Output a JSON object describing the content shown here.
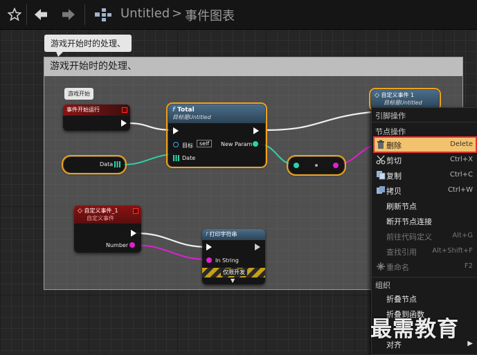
{
  "toolbar": {
    "favorite_icon": "star-outline-icon",
    "back_icon": "arrow-left-icon",
    "forward_icon": "arrow-right-icon",
    "graph_icon": "blueprint-graph-icon",
    "breadcrumb_root": "Untitled",
    "breadcrumb_separator": ">",
    "breadcrumb_current": "事件图表"
  },
  "comment": {
    "bubble_text": "游戏开始时的处理、",
    "title": "游戏开始时的处理、"
  },
  "nodes": {
    "begin_play": {
      "bubble": "游戏开始",
      "title": "事件开始运行",
      "color": "#8a1212"
    },
    "data_var": {
      "label": "Data"
    },
    "total": {
      "title": "Total",
      "subtitle": "目标是Untitled",
      "target_label": "目标",
      "self_value": "self",
      "new_param": "New Param",
      "date_label": "Date",
      "color": "#3a5a72"
    },
    "custom_event_top": {
      "title": "自定义事件 1",
      "subtitle": "目标是Untitled",
      "color": "#3a5a72"
    },
    "custom_event": {
      "title": "自定义事件_1",
      "subtitle": "自定义事件",
      "number_label": "Number",
      "color": "#8a1212"
    },
    "print_string": {
      "title": "打印字符串",
      "in_string": "In String",
      "dev_only": "仅限开发",
      "color": "#3a5a72"
    }
  },
  "context_menu": {
    "pin_header": "引脚操作",
    "node_header": "节点操作",
    "items": [
      {
        "label": "删除",
        "shortcut": "Delete",
        "icon": "trash-icon"
      },
      {
        "label": "剪切",
        "shortcut": "Ctrl+X",
        "icon": "scissors-icon"
      },
      {
        "label": "复制",
        "shortcut": "Ctrl+C",
        "icon": "copy-icon"
      },
      {
        "label": "拷贝",
        "shortcut": "Ctrl+W",
        "icon": "duplicate-icon"
      },
      {
        "label": "刷新节点",
        "shortcut": ""
      },
      {
        "label": "断开节点连接",
        "shortcut": ""
      },
      {
        "label": "前往代码定义",
        "shortcut": "Alt+G"
      },
      {
        "label": "查找引用",
        "shortcut": "Alt+Shift+F"
      },
      {
        "label": "重命名",
        "shortcut": "F2",
        "icon": "rename-icon"
      }
    ],
    "group_header": "组织",
    "group_items": [
      {
        "label": "折叠节点"
      },
      {
        "label": "折叠到函数"
      },
      {
        "label": "对齐"
      }
    ]
  },
  "watermark": "最需教育",
  "colors": {
    "exec": "#ffffff",
    "struct_pin": "#2fd1a8",
    "string_pin": "#e020d0",
    "highlight": "#f3c26e",
    "selection_outline": "#f0a21a"
  }
}
